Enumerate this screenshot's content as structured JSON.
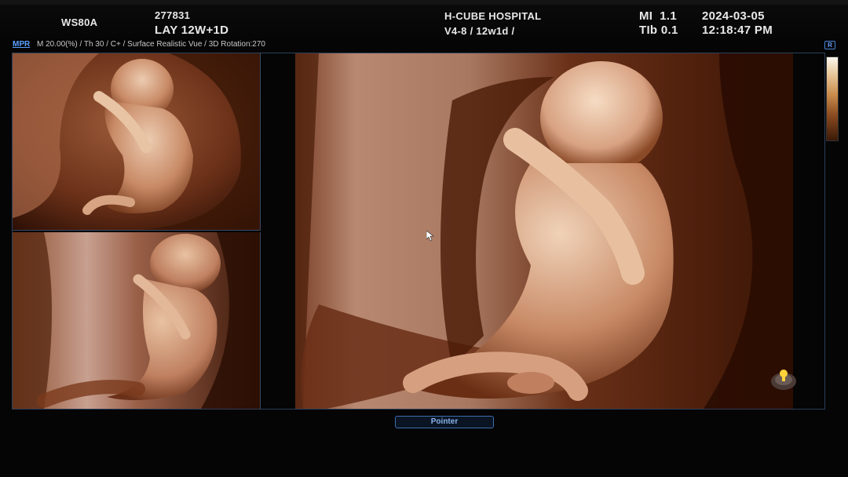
{
  "header": {
    "probe_preset": "WS80A",
    "patient_id": "277831",
    "gestational_age": "LAY 12W+1D",
    "hospital": "H-CUBE HOSPITAL",
    "probe_info": "V4-8 / 12w1d /",
    "mi_label": "MI",
    "mi_value": "1.1",
    "tib_label": "TIb",
    "tib_value": "0.1",
    "date": "2024-03-05",
    "time": "12:18:47 PM"
  },
  "subbar": {
    "mpr_tab": "MPR",
    "params": "M 20.00(%) / Th 30 / C+ / Surface Realistic Vue / 3D Rotation:270"
  },
  "r_icon": "R",
  "pointer_button": "Pointer",
  "colors": {
    "accent_blue": "#3e6fb0",
    "frame_border": "#2c3f59",
    "tissue_light": "#e8c0a0",
    "tissue_dark": "#5a2a14"
  },
  "icons": {
    "light_source": "light-source-icon",
    "cursor": "mouse-cursor-icon",
    "colorbar": "color-map-bar"
  }
}
